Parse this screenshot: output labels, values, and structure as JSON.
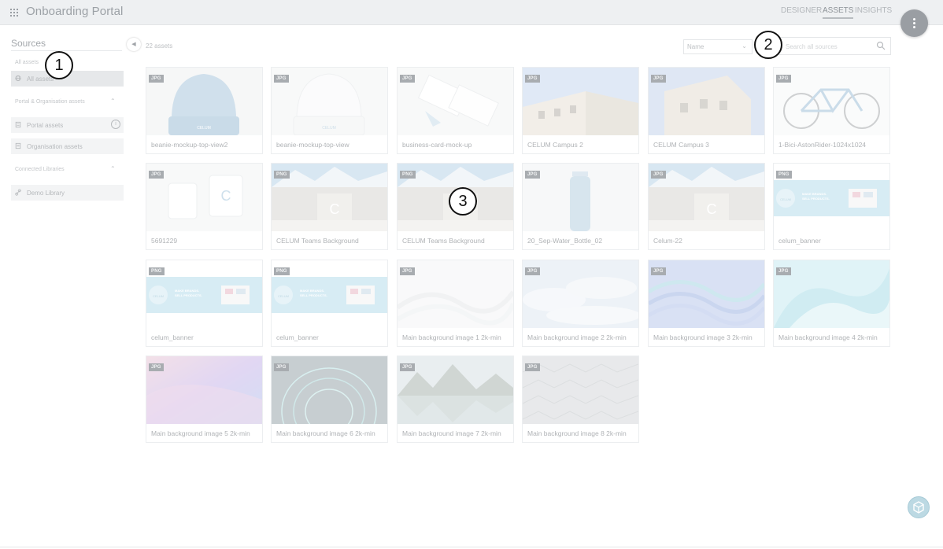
{
  "app": {
    "title": "Onboarding Portal",
    "nav": [
      "DESIGNER",
      "ASSETS",
      "INSIGHTS"
    ],
    "active_nav": "ASSETS"
  },
  "sidebar": {
    "title": "Sources",
    "all_assets_heading": "All assets",
    "all_assets_item": "All assets",
    "portal_section": "Portal & Organisation assets",
    "portal_items": [
      "Portal assets",
      "Organisation assets"
    ],
    "connected_section": "Connected Libraries",
    "connected_items": [
      "Demo Library"
    ]
  },
  "toolbar": {
    "count": "22 assets",
    "sort_value": "Name",
    "search_placeholder": "Search all sources"
  },
  "assets": [
    {
      "type": "JPG",
      "name": "beanie-mockup-top-view2",
      "thumb": "beanie-blue"
    },
    {
      "type": "JPG",
      "name": "beanie-mockup-top-view",
      "thumb": "beanie-white"
    },
    {
      "type": "JPG",
      "name": "business-card-mock-up",
      "thumb": "cards"
    },
    {
      "type": "JPG",
      "name": "CELUM Campus 2",
      "thumb": "building"
    },
    {
      "type": "JPG",
      "name": "CELUM Campus 3",
      "thumb": "building2"
    },
    {
      "type": "JPG",
      "name": "1-Bici-AstonRider-1024x1024",
      "thumb": "bike"
    },
    {
      "type": "JPG",
      "name": "5691229",
      "thumb": "mugs"
    },
    {
      "type": "PNG",
      "name": "CELUM Teams Background",
      "thumb": "office"
    },
    {
      "type": "PNG",
      "name": "CELUM Teams Background",
      "thumb": "office"
    },
    {
      "type": "JPG",
      "name": "20_Sep-Water_Bottle_02",
      "thumb": "bottle"
    },
    {
      "type": "JPG",
      "name": "Celum-22",
      "thumb": "office"
    },
    {
      "type": "PNG",
      "name": "celum_banner",
      "thumb": "banner"
    },
    {
      "type": "PNG",
      "name": "celum_banner",
      "thumb": "banner"
    },
    {
      "type": "PNG",
      "name": "celum_banner",
      "thumb": "banner"
    },
    {
      "type": "JPG",
      "name": "Main background image 1 2k-min",
      "thumb": "white-waves"
    },
    {
      "type": "JPG",
      "name": "Main background image 2 2k-min",
      "thumb": "clouds"
    },
    {
      "type": "JPG",
      "name": "Main background image 3 2k-min",
      "thumb": "blue-waves"
    },
    {
      "type": "JPG",
      "name": "Main background image 4 2k-min",
      "thumb": "cyan-waves"
    },
    {
      "type": "JPG",
      "name": "Main background image 5 2k-min",
      "thumb": "pink-gradient"
    },
    {
      "type": "JPG",
      "name": "Main background image 6 2k-min",
      "thumb": "dark-sphere"
    },
    {
      "type": "JPG",
      "name": "Main background image 7 2k-min",
      "thumb": "lake"
    },
    {
      "type": "JPG",
      "name": "Main background image 8 2k-min",
      "thumb": "hex-pattern"
    }
  ],
  "callouts": [
    "1",
    "2",
    "3"
  ]
}
